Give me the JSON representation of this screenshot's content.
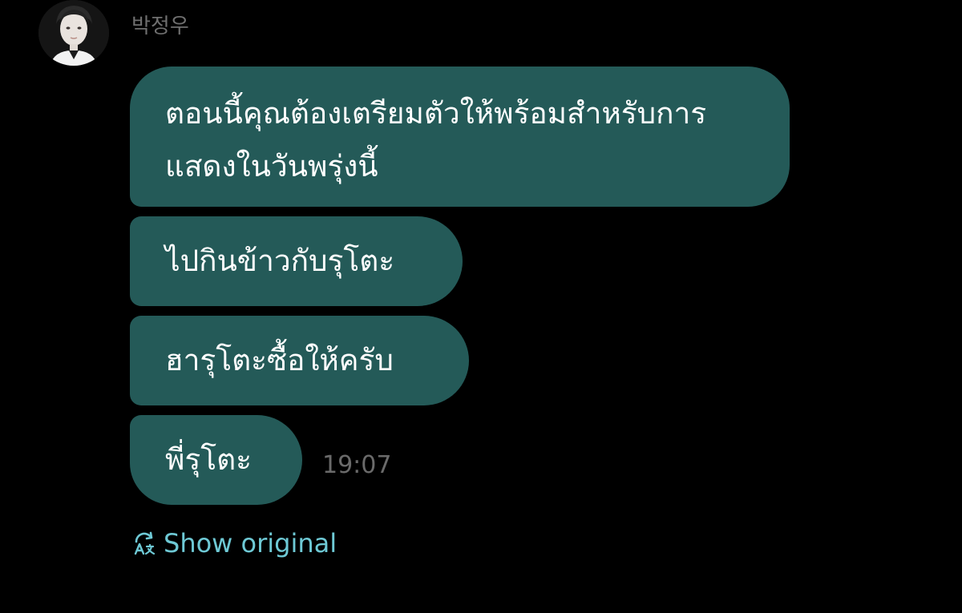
{
  "contact": {
    "name": "박정우"
  },
  "messages": [
    {
      "text": "ตอนนี้คุณต้องเตรียมตัวให้พร้อมสำหรับการแสดงในวันพรุ่งนี้"
    },
    {
      "text": "ไปกินข้าวกับรุโตะ"
    },
    {
      "text": "ฮารุโตะซื้อให้ครับ"
    },
    {
      "text": "พี่รุโตะ"
    }
  ],
  "timestamp": "19:07",
  "show_original": {
    "label": "Show original",
    "icon": "translate-icon"
  },
  "colors": {
    "background": "#000000",
    "bubble": "#245a58",
    "link": "#6ec9d5",
    "muted": "#6f6f6f"
  }
}
